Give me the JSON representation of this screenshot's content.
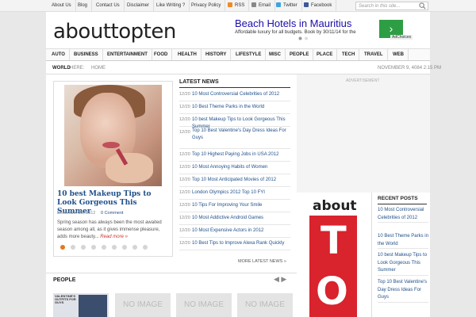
{
  "top_bar": {
    "links": [
      "About Us",
      "Blog",
      "Contact Us",
      "Disclaimer",
      "Like Writing ?",
      "Privacy Policy"
    ],
    "rss": "RSS",
    "email": "Email",
    "twitter": "Twitter",
    "facebook": "Facebook",
    "search_placeholder": "Search in this site..."
  },
  "header": {
    "logo": "abouttopten",
    "ad_title": "Beach Hotels in Mauritius",
    "ad_text": "Affordable luxury for all budgets. Book by 30/11/14 for the",
    "ad_choices": "AdChoices"
  },
  "nav": [
    "AUTO",
    "BUSINESS",
    "ENTERTAINMENT",
    "FOOD",
    "HEALTH",
    "HISTORY",
    "LIFESTYLE",
    "MISC",
    "PEOPLE",
    "PLACE",
    "TECH",
    "TRAVEL",
    "WEB"
  ],
  "breadcrumb": {
    "world": "WORLD",
    "here": "HERE:",
    "home": "HOME",
    "date": "NOVEMBER 9, 4084 2:15 PM"
  },
  "slider": {
    "title": "10 best Makeup Tips to Look Gorgeous This Summer",
    "date": "December 20, 2012",
    "comments": "0 Comment",
    "excerpt": "Spring season has always been the most awaited season among all, as it gives immense pleasure, adds more beauty...",
    "more": "Read more »",
    "dot_count": 9,
    "active_dot": 0
  },
  "latest_news": {
    "heading": "LATEST NEWS",
    "items": [
      {
        "date": "12/20",
        "title": "10 Most Controversial Celebrities of 2012"
      },
      {
        "date": "12/20",
        "title": "10 Best Theme Parks in the World"
      },
      {
        "date": "12/20",
        "title": "10 best Makeup Tips to Look Gorgeous This Summer"
      },
      {
        "date": "12/20",
        "title": "Top 10 Best Valentine's Day Dress Ideas For Guys"
      },
      {
        "date": "12/20",
        "title": "Top 10 Highest Paying Jobs in USA 2012"
      },
      {
        "date": "12/20",
        "title": "10 Most Annoying Habits of Women"
      },
      {
        "date": "12/20",
        "title": "Top 10 Most Anticipated Movies of 2012"
      },
      {
        "date": "12/20",
        "title": "London Olympics 2012 Top 10 FYI"
      },
      {
        "date": "12/20",
        "title": "10 Tips For Improving Your Smile"
      },
      {
        "date": "12/20",
        "title": "10 Most Addictive Android Games"
      },
      {
        "date": "12/20",
        "title": "10 Most Expensive Actors in 2012"
      },
      {
        "date": "12/20",
        "title": "10 Best Tips to Improve Alexa Rank Quickly"
      }
    ],
    "more": "MORE LATEST NEWS »"
  },
  "people": {
    "heading": "PEOPLE",
    "arrows": "◀ ▶",
    "thumb_label": "VALENTINE'S OUTFITS FOR GUYS",
    "no_image": "NO IMAGE"
  },
  "sidebar": {
    "advertisement": "ADVERTISEMENT",
    "about_word": "about",
    "about_letter": "T",
    "about_letter2": "O",
    "recent_heading": "RECENT POSTS",
    "recent_posts": [
      "10 Most Controversial Celebrities of 2012",
      "10 Best Theme Parks in the World",
      "10 best Makeup Tips to Look Gorgeous This Summer",
      "Top 10 Best Valentine's Day Dress Ideas For Guys"
    ]
  }
}
